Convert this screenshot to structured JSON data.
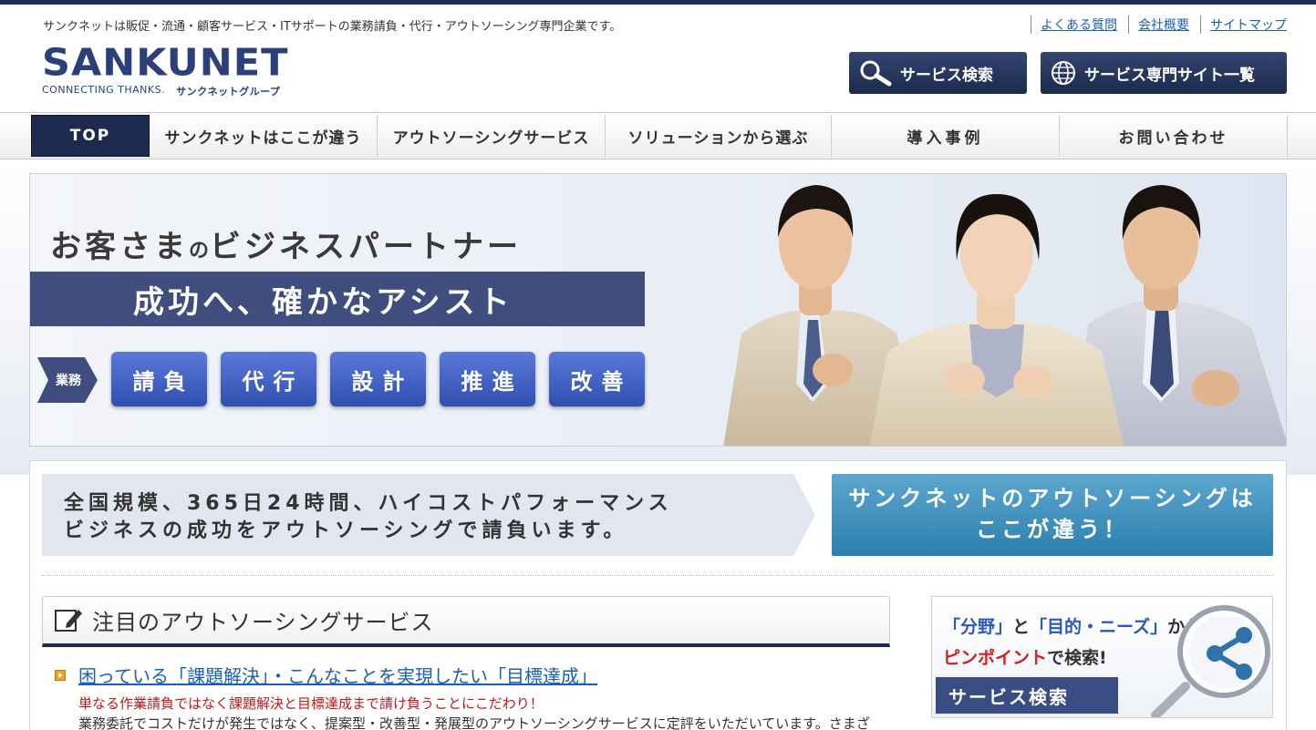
{
  "header": {
    "tagline": "サンクネットは販促・流通・顧客サービス・ITサポートの業務請負・代行・アウトソーシング専門企業です。",
    "links": [
      "よくある質問",
      "会社概要",
      "サイトマップ"
    ],
    "logo_text": "SANKUNET",
    "logo_sub_en": "CONNECTING THANKS.",
    "logo_sub_jp": "サンクネットグループ",
    "search_button": "サービス検索",
    "sites_button": "サービス専門サイト一覧"
  },
  "nav": {
    "items": [
      "TOP",
      "サンクネットはここが違う",
      "アウトソーシングサービス",
      "ソリューションから選ぶ",
      "導入事例",
      "お問い合わせ"
    ],
    "active": "TOP"
  },
  "hero": {
    "title_part1": "お客さま",
    "title_small": "の",
    "title_part2": "ビジネスパートナー",
    "bar_text": "成功へ、確かなアシスト",
    "business_tag": "業務",
    "business_buttons": [
      "請負",
      "代行",
      "設計",
      "推進",
      "改善"
    ]
  },
  "intro": {
    "line1": "全国規模、365日24時間、ハイコストパフォーマンス",
    "line2": "ビジネスの成功をアウトソーシングで請負います。",
    "diff_line1": "サンクネットのアウトソーシングは",
    "diff_line2": "ここが違う！"
  },
  "featured": {
    "heading": "注目のアウトソーシングサービス",
    "link": "困っている「課題解決」・こんなことを実現したい「目標達成」",
    "red_text": "単なる作業請負ではなく課題解決と目標達成まで請け負うことにこだわり！",
    "body": "業務委託でコストだけが発生ではなく、提案型・改善型・発展型のアウトソーシングサービスに定評をいただいています。さまざまな業"
  },
  "side_banner": {
    "q1": "「分野」",
    "and": "と",
    "q2": "「目的・ニーズ」",
    "from": "から",
    "pinpoint": "ピンポイント",
    "search_suffix": "で検索!",
    "button": "サービス検索"
  },
  "colors": {
    "navy": "#1c2a50",
    "link_blue": "#1a5fb4",
    "accent_red": "#c01818",
    "teal_button": "#2e7fae"
  }
}
